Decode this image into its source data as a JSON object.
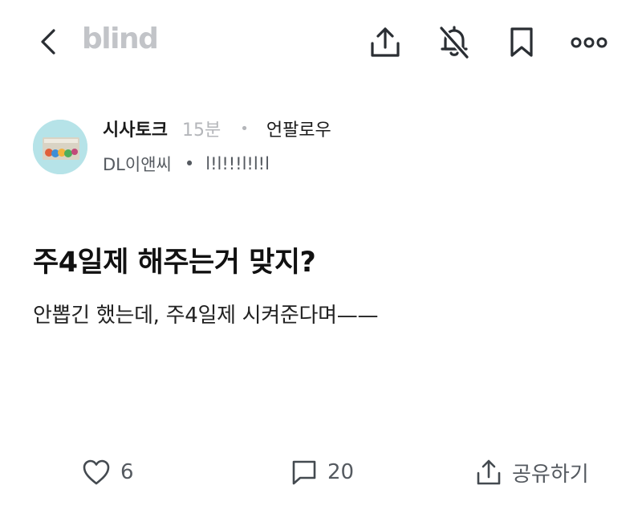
{
  "header": {
    "logo": "blind",
    "icons": [
      "back-icon",
      "share-icon",
      "notifications-off-icon",
      "bookmark-icon",
      "more-icon"
    ]
  },
  "post": {
    "channel": "시사토크",
    "time": "15분",
    "follow_label": "언팔로우",
    "company": "DL이앤씨",
    "nickname": "l!l!!!l!l!l",
    "title": "주4일제 해주는거 맞지?",
    "body": "안뽑긴 했는데, 주4일제 시켜준다며——"
  },
  "actions": {
    "likes": "6",
    "comments": "20",
    "share_label": "공유하기"
  },
  "colors": {
    "text": "#111111",
    "muted": "#b4b6ba",
    "logo": "#c2c4c8",
    "icon": "#2a2e33"
  }
}
